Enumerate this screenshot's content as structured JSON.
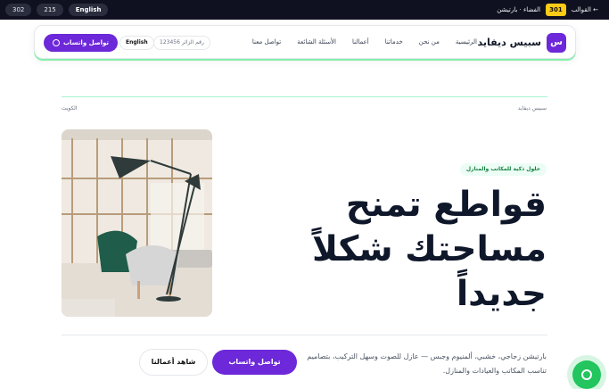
{
  "topbar": {
    "pills": [
      "302",
      "215",
      "English"
    ],
    "right": {
      "back": "← القوالب",
      "badge": "301",
      "text": "الفضاء · بارتيشن"
    }
  },
  "nav": {
    "logo_letter": "س",
    "brand": "سبيس ديفايد",
    "links": [
      "الرئيسية",
      "من نحن",
      "خدماتنا",
      "أعمالنا",
      "الأسئلة الشائعة",
      "تواصل معنا"
    ],
    "phone": "123456 رقم الزائر",
    "lang": "English",
    "whatsapp": "تواصل واتساب"
  },
  "breadcrumb": {
    "right": "سبيس ديفايد",
    "left": "الكويت"
  },
  "hero": {
    "tag": "حلول ذكية للمكاتب والمنازل",
    "headline_lines": [
      "قواطع تمنح",
      "مساحتك شكلاً",
      "جديداً"
    ],
    "desc": "بارتيشن زجاجي، خشبي، ألمنيوم وجبس — عازل للصوت وسهل التركيب، بتصاميم تناسب المكاتب والعيادات والمنازل.",
    "cta_primary": "تواصل واتساب",
    "cta_secondary": "شاهد أعمالنا"
  },
  "colors": {
    "accent": "#6d28d9",
    "green": "#22c55e",
    "dark": "#0f1120"
  }
}
